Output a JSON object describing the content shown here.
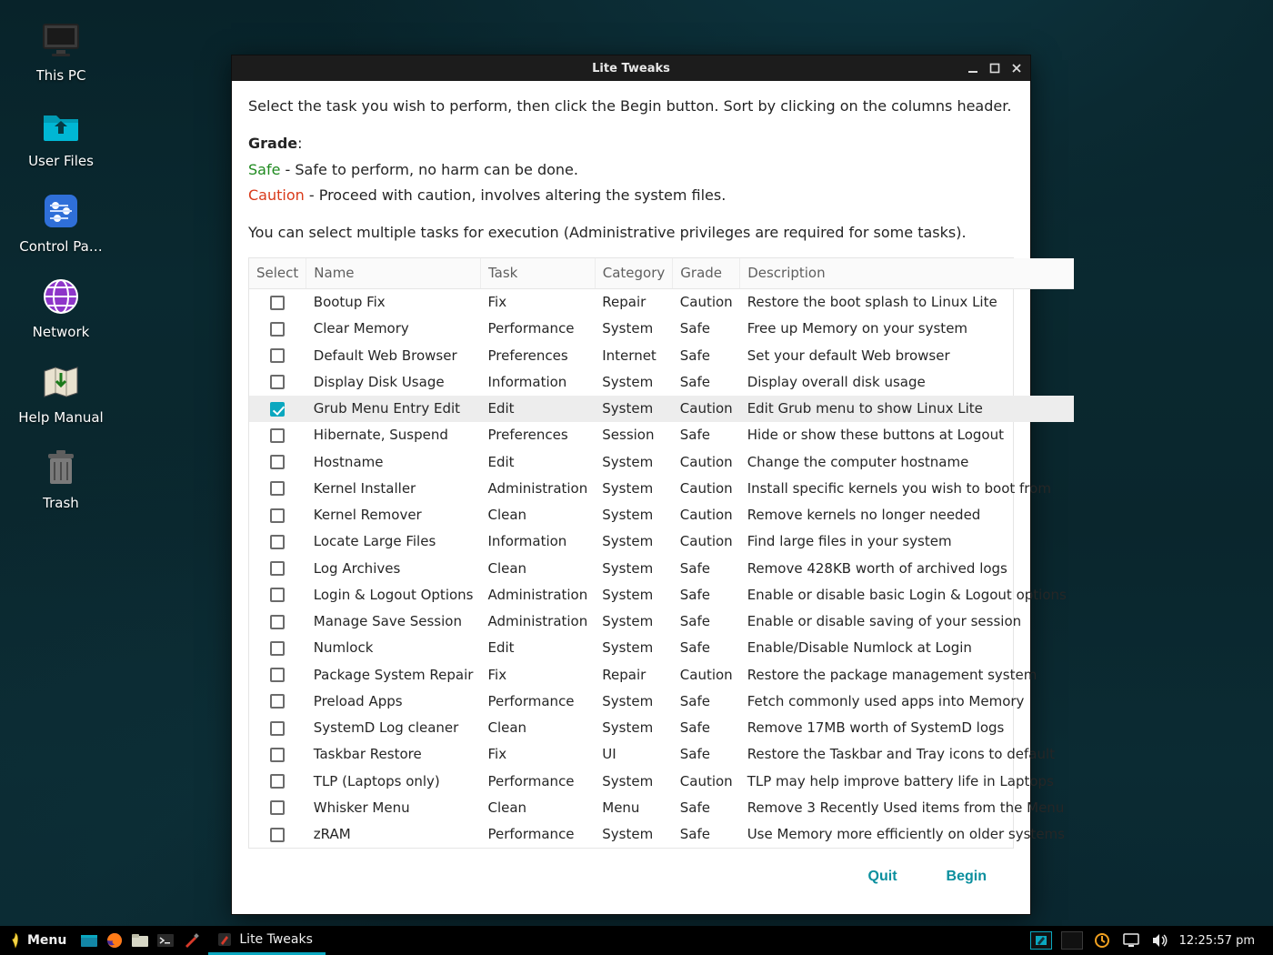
{
  "desktop": {
    "icons": [
      {
        "name": "this-pc",
        "label": "This PC",
        "glyph": "monitor",
        "tint": "#616161"
      },
      {
        "name": "user-files",
        "label": "User Files",
        "glyph": "folder",
        "tint": "#00b7d4"
      },
      {
        "name": "control-panel",
        "label": "Control Pa…",
        "glyph": "sliders",
        "tint": "#2f6fd8"
      },
      {
        "name": "network",
        "label": "Network",
        "glyph": "globe",
        "tint": "#8e36c9"
      },
      {
        "name": "help-manual",
        "label": "Help Manual",
        "glyph": "map",
        "tint": "#e9e2cf"
      },
      {
        "name": "trash",
        "label": "Trash",
        "glyph": "trash",
        "tint": "#7a7a7a"
      }
    ]
  },
  "window": {
    "title": "Lite Tweaks",
    "intro": {
      "line1": "Select the task you wish to perform, then click the Begin button. Sort by clicking on the columns header.",
      "grade_label": "Grade",
      "safe_word": "Safe",
      "safe_desc": " - Safe to perform, no harm can be done.",
      "caution_word": "Caution",
      "caution_desc": " - Proceed with caution, involves altering the system files.",
      "line2": "You can select multiple tasks for execution (Administrative privileges are required for some tasks)."
    },
    "columns": {
      "select": "Select",
      "name": "Name",
      "task": "Task",
      "category": "Category",
      "grade": "Grade",
      "description": "Description"
    },
    "rows": [
      {
        "checked": false,
        "name": "Bootup Fix",
        "task": "Fix",
        "category": "Repair",
        "grade": "Caution",
        "desc": "Restore the boot splash to Linux Lite"
      },
      {
        "checked": false,
        "name": "Clear Memory",
        "task": "Performance",
        "category": "System",
        "grade": "Safe",
        "desc": "Free up Memory on your system"
      },
      {
        "checked": false,
        "name": "Default Web Browser",
        "task": "Preferences",
        "category": "Internet",
        "grade": "Safe",
        "desc": "Set your default Web browser"
      },
      {
        "checked": false,
        "name": "Display Disk Usage",
        "task": "Information",
        "category": "System",
        "grade": "Safe",
        "desc": "Display overall disk usage"
      },
      {
        "checked": true,
        "name": "Grub Menu Entry Edit",
        "task": "Edit",
        "category": "System",
        "grade": "Caution",
        "desc": "Edit Grub menu to show Linux Lite"
      },
      {
        "checked": false,
        "name": "Hibernate, Suspend",
        "task": "Preferences",
        "category": "Session",
        "grade": "Safe",
        "desc": "Hide or show these buttons at Logout"
      },
      {
        "checked": false,
        "name": "Hostname",
        "task": "Edit",
        "category": "System",
        "grade": "Caution",
        "desc": "Change the computer hostname"
      },
      {
        "checked": false,
        "name": "Kernel Installer",
        "task": "Administration",
        "category": "System",
        "grade": "Caution",
        "desc": "Install specific kernels you wish to boot from"
      },
      {
        "checked": false,
        "name": "Kernel Remover",
        "task": "Clean",
        "category": "System",
        "grade": "Caution",
        "desc": "Remove kernels no longer needed"
      },
      {
        "checked": false,
        "name": "Locate Large Files",
        "task": "Information",
        "category": "System",
        "grade": "Caution",
        "desc": "Find large files in your system"
      },
      {
        "checked": false,
        "name": "Log Archives",
        "task": "Clean",
        "category": "System",
        "grade": "Safe",
        "desc": "Remove 428KB worth of archived logs"
      },
      {
        "checked": false,
        "name": "Login & Logout Options",
        "task": "Administration",
        "category": "System",
        "grade": "Safe",
        "desc": "Enable or disable basic Login & Logout options"
      },
      {
        "checked": false,
        "name": "Manage Save Session",
        "task": "Administration",
        "category": "System",
        "grade": "Safe",
        "desc": "Enable or disable saving of your session"
      },
      {
        "checked": false,
        "name": "Numlock",
        "task": "Edit",
        "category": "System",
        "grade": "Safe",
        "desc": "Enable/Disable Numlock at Login"
      },
      {
        "checked": false,
        "name": "Package System Repair",
        "task": "Fix",
        "category": "Repair",
        "grade": "Caution",
        "desc": "Restore the package management system"
      },
      {
        "checked": false,
        "name": "Preload Apps",
        "task": "Performance",
        "category": "System",
        "grade": "Safe",
        "desc": "Fetch commonly used apps into Memory"
      },
      {
        "checked": false,
        "name": "SystemD Log cleaner",
        "task": "Clean",
        "category": "System",
        "grade": "Safe",
        "desc": "Remove 17MB worth of SystemD logs"
      },
      {
        "checked": false,
        "name": "Taskbar Restore",
        "task": "Fix",
        "category": "UI",
        "grade": "Safe",
        "desc": "Restore the Taskbar and Tray icons to default"
      },
      {
        "checked": false,
        "name": "TLP (Laptops only)",
        "task": "Performance",
        "category": "System",
        "grade": "Caution",
        "desc": "TLP may help improve battery life in Laptops"
      },
      {
        "checked": false,
        "name": "Whisker Menu",
        "task": "Clean",
        "category": "Menu",
        "grade": "Safe",
        "desc": "Remove 3 Recently Used items from the Menu"
      },
      {
        "checked": false,
        "name": "zRAM",
        "task": "Performance",
        "category": "System",
        "grade": "Safe",
        "desc": "Use Memory more efficiently on older systems"
      }
    ],
    "buttons": {
      "quit": "Quit",
      "begin": "Begin"
    }
  },
  "taskbar": {
    "menu_label": "Menu",
    "active_task": "Lite Tweaks",
    "clock": "12:25:57 pm"
  }
}
